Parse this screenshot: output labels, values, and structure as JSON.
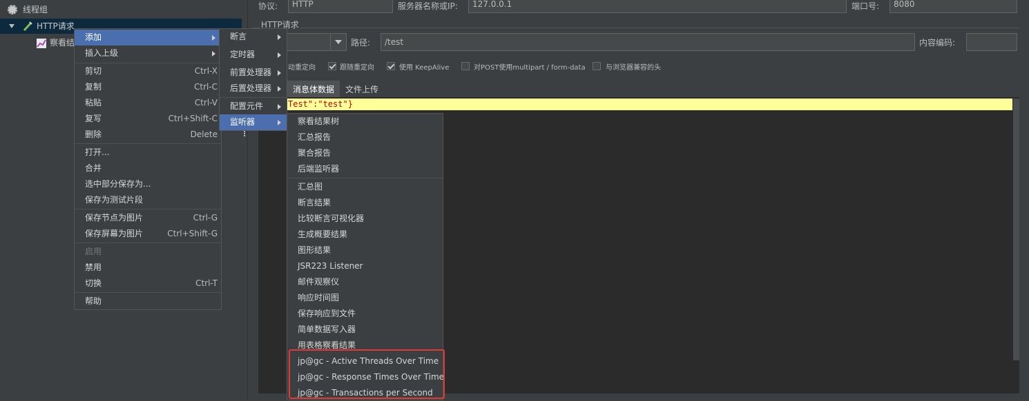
{
  "tree": {
    "thread_group": "线程组",
    "http_request": "HTTP请求",
    "view_results": "察看结"
  },
  "http": {
    "protocol_label": "协议:",
    "protocol_value": "HTTP",
    "server_label": "服务器名称或IP:",
    "server_value": "127.0.0.1",
    "port_label": "端口号:",
    "port_value": "8080",
    "section_title": "HTTP请求",
    "path_label": "路径:",
    "path_value": "/test",
    "encoding_label": "内容编码:",
    "encoding_value": "",
    "cb_redirect_auto": "动重定向",
    "cb_follow_redirect": "跟随重定向",
    "cb_keepalive": "使用 KeepAlive",
    "cb_multipart": "对POST使用multipart / form-data",
    "cb_browser_headers": "与浏览器兼容的头",
    "tab_body": "消息体数据",
    "tab_files": "文件上传",
    "body_text": "Test\":\"test\"}"
  },
  "context_menu": {
    "add": "添加",
    "insert_parent": "插入上级",
    "cut": "剪切",
    "cut_key": "Ctrl-X",
    "copy": "复制",
    "copy_key": "Ctrl-C",
    "paste": "粘贴",
    "paste_key": "Ctrl-V",
    "duplicate": "复写",
    "duplicate_key": "Ctrl+Shift-C",
    "delete": "删除",
    "delete_key": "Delete",
    "open": "打开...",
    "merge": "合并",
    "save_selection": "选中部分保存为...",
    "save_fragment": "保存为测试片段",
    "save_node_image": "保存节点为图片",
    "save_node_image_key": "Ctrl-G",
    "save_screen_image": "保存屏幕为图片",
    "save_screen_image_key": "Ctrl+Shift-G",
    "enable": "启用",
    "disable": "禁用",
    "toggle": "切换",
    "toggle_key": "Ctrl-T",
    "help": "帮助"
  },
  "add_submenu": {
    "assertion": "断言",
    "timer": "定时器",
    "preprocessor": "前置处理器",
    "postprocessor": "后置处理器",
    "config": "配置元件",
    "listener": "监听器"
  },
  "listener_submenu": [
    "察看结果树",
    "汇总报告",
    "聚合报告",
    "后端监听器",
    "汇总图",
    "断言结果",
    "比较断言可视化器",
    "生成概要结果",
    "图形结果",
    "JSR223 Listener",
    "邮件观察仪",
    "响应时间图",
    "保存响应到文件",
    "简单数据写入器",
    "用表格察看结果",
    "jp@gc - Active Threads Over Time",
    "jp@gc - Response Times Over Time",
    "jp@gc - Transactions per Second"
  ],
  "colors": {
    "highlight": "#4b6eaf",
    "box_outline": "#e53935",
    "editor_line": "#ffff99"
  }
}
